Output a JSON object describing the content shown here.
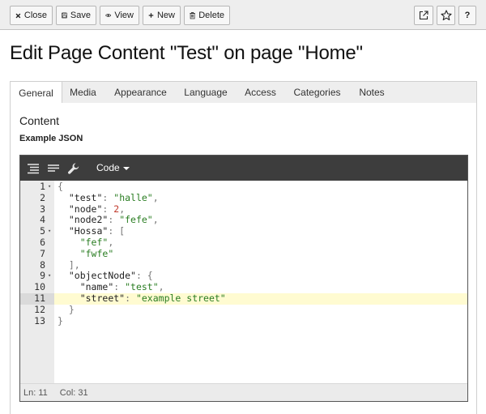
{
  "toolbar": {
    "close_label": "Close",
    "save_label": "Save",
    "view_label": "View",
    "new_label": "New",
    "delete_label": "Delete"
  },
  "page_title": "Edit Page Content \"Test\" on page \"Home\"",
  "tabs": [
    {
      "label": "General",
      "active": true
    },
    {
      "label": "Media",
      "active": false
    },
    {
      "label": "Appearance",
      "active": false
    },
    {
      "label": "Language",
      "active": false
    },
    {
      "label": "Access",
      "active": false
    },
    {
      "label": "Categories",
      "active": false
    },
    {
      "label": "Notes",
      "active": false
    }
  ],
  "section_title": "Content",
  "field_label": "Example JSON",
  "editor": {
    "mode_label": "Code",
    "lines": [
      {
        "n": "1",
        "fold": true,
        "tokens": [
          [
            "p",
            "{"
          ]
        ]
      },
      {
        "n": "2",
        "tokens": [
          [
            "p",
            "  "
          ],
          [
            "key",
            "\"test\""
          ],
          [
            "p",
            ": "
          ],
          [
            "str",
            "\"halle\""
          ],
          [
            "p",
            ","
          ]
        ]
      },
      {
        "n": "3",
        "tokens": [
          [
            "p",
            "  "
          ],
          [
            "key",
            "\"node\""
          ],
          [
            "p",
            ": "
          ],
          [
            "num",
            "2"
          ],
          [
            "p",
            ","
          ]
        ]
      },
      {
        "n": "4",
        "tokens": [
          [
            "p",
            "  "
          ],
          [
            "key",
            "\"node2\""
          ],
          [
            "p",
            ": "
          ],
          [
            "str",
            "\"fefe\""
          ],
          [
            "p",
            ","
          ]
        ]
      },
      {
        "n": "5",
        "fold": true,
        "tokens": [
          [
            "p",
            "  "
          ],
          [
            "key",
            "\"Hossa\""
          ],
          [
            "p",
            ": ["
          ]
        ]
      },
      {
        "n": "6",
        "tokens": [
          [
            "p",
            "    "
          ],
          [
            "str",
            "\"fef\""
          ],
          [
            "p",
            ","
          ]
        ]
      },
      {
        "n": "7",
        "tokens": [
          [
            "p",
            "    "
          ],
          [
            "str",
            "\"fwfe\""
          ]
        ]
      },
      {
        "n": "8",
        "tokens": [
          [
            "p",
            "  ],"
          ]
        ]
      },
      {
        "n": "9",
        "fold": true,
        "tokens": [
          [
            "p",
            "  "
          ],
          [
            "key",
            "\"objectNode\""
          ],
          [
            "p",
            ": {"
          ]
        ]
      },
      {
        "n": "10",
        "tokens": [
          [
            "p",
            "    "
          ],
          [
            "key",
            "\"name\""
          ],
          [
            "p",
            ": "
          ],
          [
            "str",
            "\"test\""
          ],
          [
            "p",
            ","
          ]
        ]
      },
      {
        "n": "11",
        "highlight": true,
        "tokens": [
          [
            "p",
            "    "
          ],
          [
            "key",
            "\"street\""
          ],
          [
            "p",
            ": "
          ],
          [
            "str",
            "\"example street\""
          ]
        ]
      },
      {
        "n": "12",
        "tokens": [
          [
            "p",
            "  }"
          ]
        ]
      },
      {
        "n": "13",
        "tokens": [
          [
            "p",
            "}"
          ]
        ]
      }
    ],
    "status_ln": "Ln: 11",
    "status_col": "Col: 31"
  },
  "icons": {
    "close": "close-icon",
    "save": "floppy-disk-icon",
    "view": "eye-icon",
    "new": "plus-icon",
    "delete": "trash-icon",
    "external": "external-link-icon",
    "star": "star-icon",
    "help": "question-icon",
    "format": "format-code-icon",
    "compact": "compact-code-icon",
    "repair": "wrench-icon"
  },
  "help_label": "?"
}
